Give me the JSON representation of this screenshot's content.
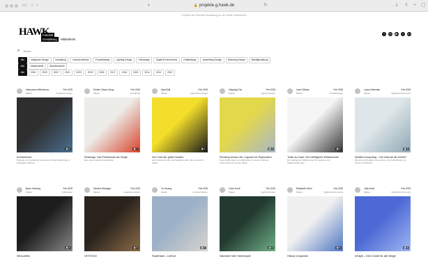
{
  "browser": {
    "url": "projekte.g.hawk.de",
    "notice": "Projekte der Fakultät Gestaltung an der HAWK Hildesheim"
  },
  "logo": {
    "mark": "HAWK",
    "line1": "Fakultät",
    "line2": "Gestaltung",
    "line3": "Hildesheim"
  },
  "search": {
    "placeholder": "Suche"
  },
  "filters": {
    "row1": [
      "Alle",
      "Integrierte Design",
      "Gestaltung",
      "Innenarchitektur",
      "Produktdesign",
      "Lighting Design",
      "Farbdesign",
      "Digital Environments",
      "Grafikdesign",
      "Advertising Design",
      "Branding Design",
      "Metallgestaltung"
    ],
    "row2": [
      "Alle",
      "Masterarbeit",
      "Bachelorarbeit"
    ],
    "row3": [
      "Alle",
      "2024",
      "2023",
      "2022",
      "2021",
      "2020",
      "2019",
      "2018",
      "2017",
      "2016",
      "2015",
      "2014",
      "2013",
      "2012"
    ]
  },
  "cards": [
    {
      "author": "Hatsumeru Milenkova",
      "role": "Master",
      "semester": "Feb 2025",
      "category": "Integrierte Design",
      "title": "Komfortzone",
      "desc": "Strategie zur Gestaltung innovativer Online-Werkzeuge in kollegialen Räumen",
      "count": "6",
      "colors": [
        "#2e2e2e",
        "#4b6f90"
      ]
    },
    {
      "author": "Emilie Chiara Hung",
      "role": "Master",
      "semester": "Feb 2025",
      "category": "Gestaltung",
      "title": "Redesign: Das Patriarchat der Dinge",
      "desc": "Eine neue visuelle Organisation",
      "count": "7",
      "colors": [
        "#ecece8",
        "#d8452e"
      ]
    },
    {
      "author": "Alya Brill",
      "role": "Master",
      "semester": "Feb 2025",
      "category": "Advertising Design",
      "title": "Der Club der guten Nudeln",
      "desc": "Ein Podcast für alle, die Pastafans sind, oder es werden wollen",
      "count": "6",
      "colors": [
        "#f3de2b",
        "#1b1b1b"
      ]
    },
    {
      "author": "Haiyang Fan",
      "role": "Master",
      "semester": "Feb 2025",
      "category": "Lighting Design",
      "title": "Reviving Urban Life: Capsule for Exploration",
      "desc": "Neue Erfahrungen und Aktivitäten in unserer urbanen Lebenswelt für unseren Alltag",
      "count": "4",
      "colors": [
        "#e3d84c",
        "#a9b7c7"
      ]
    },
    {
      "author": "Lars Göthas",
      "role": "Master",
      "semester": "Feb 2025",
      "category": "Produktdesign",
      "title": "Trash-to-Cash: Der intelligente Müllsammler",
      "desc": "Ein intelligenter Müllsammler für Gewerbe und Stadtverwaltungen",
      "count": "5",
      "colors": [
        "#f5f5f5",
        "#3a3a3a"
      ]
    },
    {
      "author": "Laura Hämmler",
      "role": "Master",
      "semester": "Feb 2025",
      "category": "Digital Environments",
      "title": "Spatial Computing – Die Zukunft der Arbeit?",
      "desc": "Remote und Spatial Computing an der Schnittstelle von Arbeit und Präsenz",
      "count": "5",
      "colors": [
        "#dfe6ea",
        "#8fa9b4"
      ]
    },
    {
      "author": "Bram Herberg",
      "role": "Master",
      "semester": "Feb 2025",
      "category": "Farbdesign",
      "title": "Silhouetten",
      "desc": "",
      "count": "4",
      "colors": [
        "#1d1d1d",
        "#888888"
      ]
    },
    {
      "author": "Sandra Hüsinger",
      "role": "Master",
      "semester": "Feb 2025",
      "category": "Integrierte Design",
      "title": "VESTIGIO",
      "desc": "",
      "count": "5",
      "colors": [
        "#2a241d",
        "#8b6b48"
      ]
    },
    {
      "author": "Yu Huang",
      "role": "Master",
      "semester": "Feb 2025",
      "category": "Innenarchitektur",
      "title": "StadtOase – Lebhof",
      "desc": "",
      "count": "7",
      "colors": [
        "#9cb1c7",
        "#d7d4cd"
      ]
    },
    {
      "author": "Chris Knoll",
      "role": "Master",
      "semester": "Feb 2025",
      "category": "Lighting Design",
      "title": "Nächster Halt: Heterotopie",
      "desc": "",
      "count": "6",
      "colors": [
        "#223a30",
        "#6fae86"
      ]
    },
    {
      "author": "Elisabeth Kühn",
      "role": "Master",
      "semester": "Feb 2025",
      "category": "Digital Environments",
      "title": "History Unpacked",
      "desc": "",
      "count": "5",
      "colors": [
        "#f0f0f0",
        "#5077c2"
      ]
    },
    {
      "author": "Julia Kraft",
      "role": "Master",
      "semester": "Feb 2025",
      "category": "Digital Environments",
      "title": "InSight – Dein Guide für alle Wege!",
      "desc": "",
      "count": "6",
      "colors": [
        "#4c69d6",
        "#a0b6f0"
      ]
    }
  ]
}
